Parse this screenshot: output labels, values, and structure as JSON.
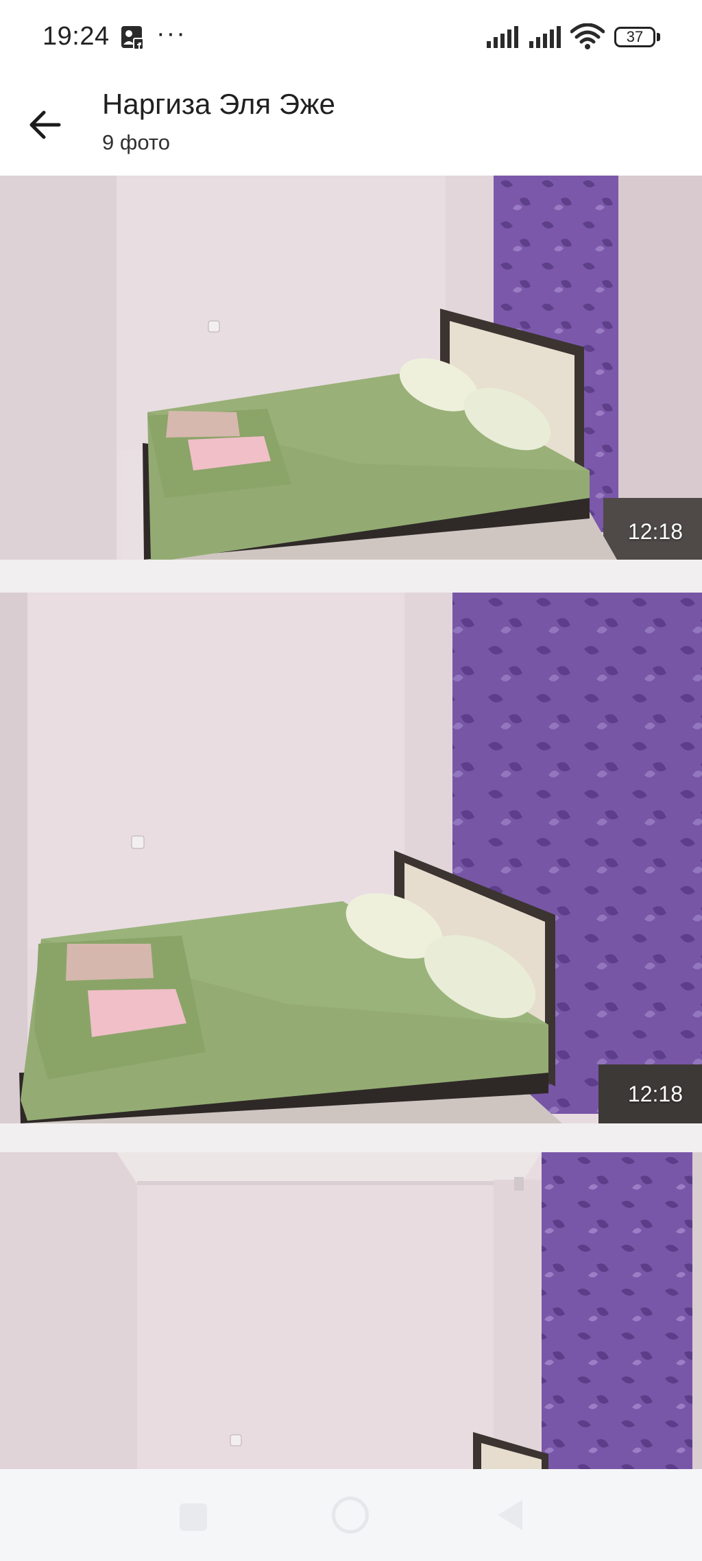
{
  "status_bar": {
    "time": "19:24",
    "more": "···",
    "battery": "37",
    "icons": [
      "facebook-app-icon",
      "signal-icon",
      "signal-icon",
      "wifi-icon",
      "battery-icon"
    ]
  },
  "header": {
    "title": "Наргиза Эля Эже",
    "subtitle": "9 фото",
    "back_icon": "arrow-left-icon"
  },
  "gallery": {
    "photos": [
      {
        "time": "12:18"
      },
      {
        "time": "12:18"
      },
      {
        "time": ""
      }
    ]
  },
  "nav_bar": {
    "icons": [
      "recents-icon",
      "home-icon",
      "back-icon"
    ]
  },
  "colors": {
    "wall": "#e8dbe0",
    "curtain": "#7a58a8",
    "bedding": "#93ab72",
    "headboard": "#3b3430",
    "towel": "#efbfc8"
  }
}
